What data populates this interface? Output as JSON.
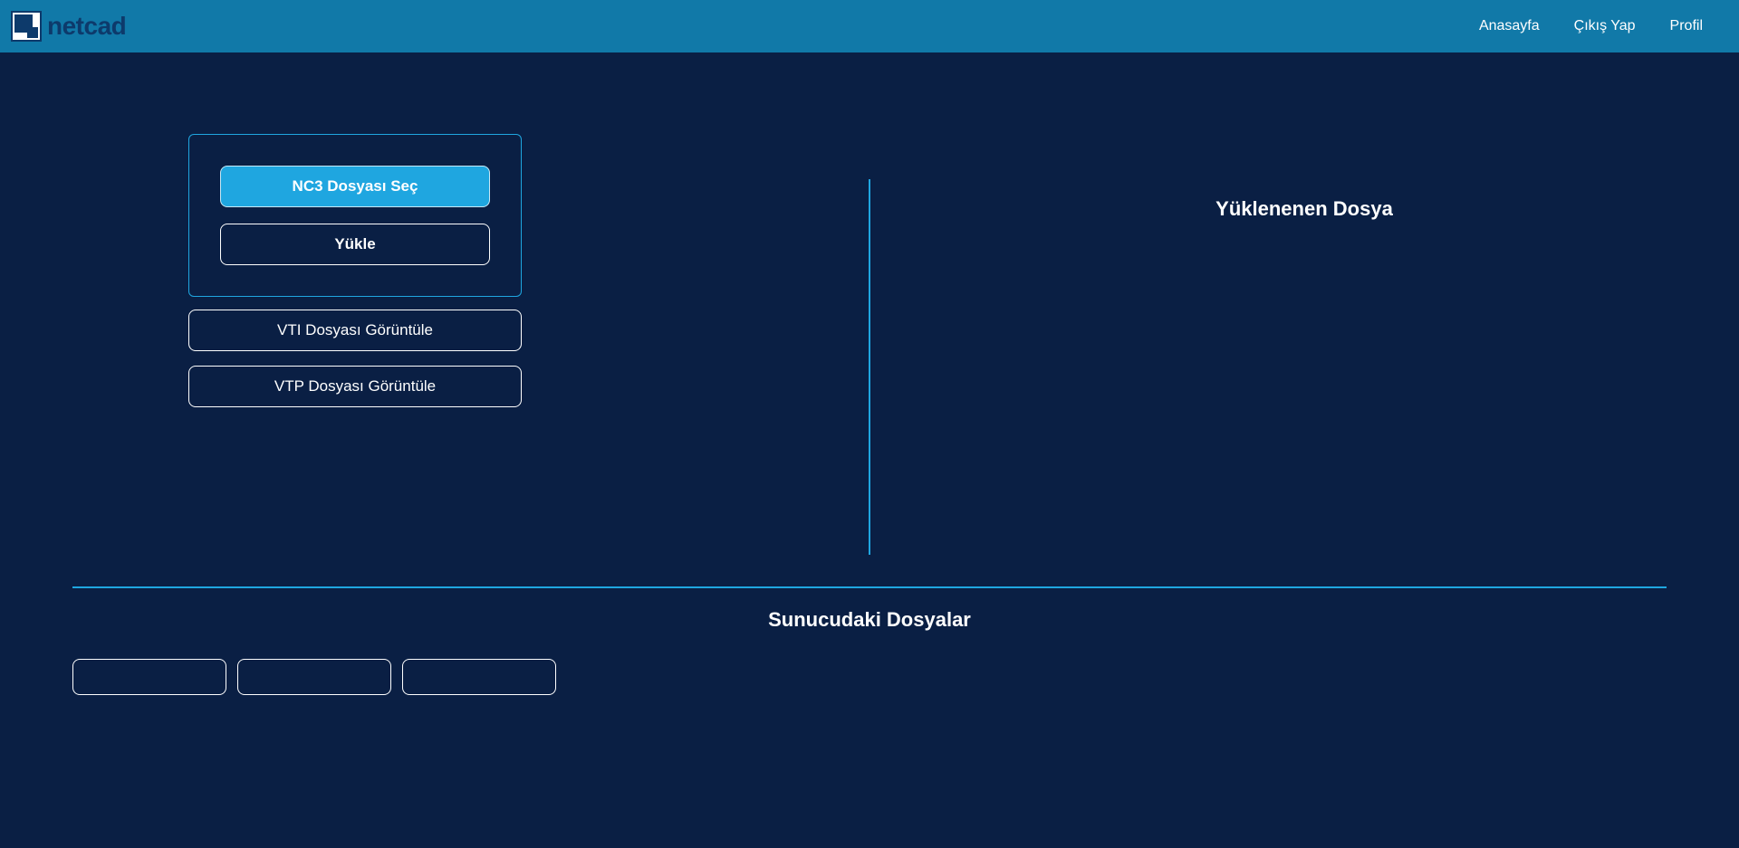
{
  "header": {
    "logo_text": "netcad",
    "nav": {
      "home": "Anasayfa",
      "logout": "Çıkış Yap",
      "profile": "Profil"
    }
  },
  "left_panel": {
    "select_file_button": "NC3 Dosyası Seç",
    "upload_button": "Yükle",
    "view_vti_button": "VTI Dosyası Görüntüle",
    "view_vtp_button": "VTP Dosyası Görüntüle"
  },
  "right_panel": {
    "title": "Yüklenenen Dosya"
  },
  "bottom_section": {
    "title": "Sunucudaki Dosyalar"
  }
}
